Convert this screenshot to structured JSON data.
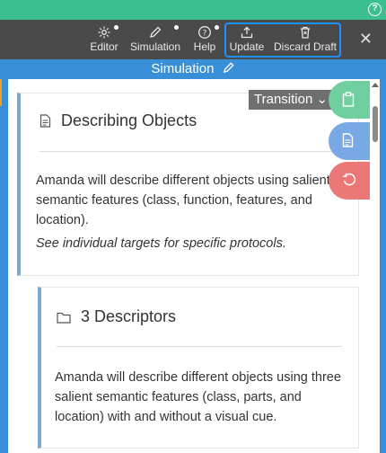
{
  "help_icon_char": "?",
  "toolbar": {
    "editor_label": "Editor",
    "simulation_label": "Simulation",
    "help_label": "Help",
    "update_label": "Update",
    "discard_label": "Discard Draft",
    "close_char": "✕"
  },
  "banner": {
    "title": "Simulation"
  },
  "transition_label": "Transition ⌄",
  "cards": [
    {
      "title": "Describing Objects",
      "body": "Amanda will describe different objects using salient semantic features (class, function, features, and location).",
      "note": "See individual targets for specific protocols."
    },
    {
      "title": "3 Descriptors",
      "body": "Amanda will describe different objects using three salient semantic features (class, parts, and location) with and without a visual cue."
    }
  ],
  "colors": {
    "accent_green": "#3cbf8e",
    "toolbar_bg": "#4a4a4a",
    "banner_blue": "#3a8fd9",
    "highlight": "#1e90ff",
    "fab_green": "#6fcf9f",
    "fab_blue": "#78a9e4",
    "fab_red": "#ec7777"
  },
  "icons": [
    "gear-icon",
    "pencil-icon",
    "help-icon",
    "upload-icon",
    "trash-icon",
    "close-icon",
    "document-icon",
    "folder-icon",
    "clipboard-icon",
    "file-icon",
    "undo-icon"
  ]
}
